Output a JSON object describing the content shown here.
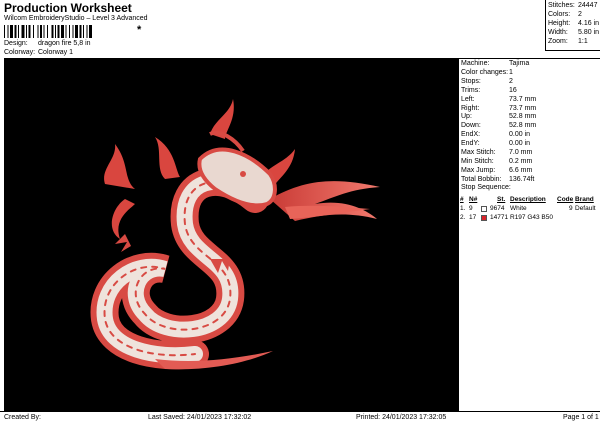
{
  "header": {
    "title": "Production Worksheet",
    "subtitle": "Wilcom EmbroideryStudio – Level 3 Advanced",
    "barcode_star": "*"
  },
  "meta": [
    {
      "key": "Design:",
      "value": "dragon fire 5,8 in"
    },
    {
      "key": "Colorway:",
      "value": "Colorway 1"
    }
  ],
  "summary": [
    {
      "key": "Stitches:",
      "value": "24447"
    },
    {
      "key": "Colors:",
      "value": "2"
    },
    {
      "key": "Height:",
      "value": "4.16 in"
    },
    {
      "key": "Width:",
      "value": "5.80 in"
    },
    {
      "key": "Zoom:",
      "value": "1:1"
    }
  ],
  "details": [
    {
      "key": "Machine:",
      "value": "Tajima"
    },
    {
      "key": "Color changes:",
      "value": "1"
    },
    {
      "key": "Stops:",
      "value": "2"
    },
    {
      "key": "Trims:",
      "value": "16"
    },
    {
      "key": "Left:",
      "value": "73.7 mm"
    },
    {
      "key": "Right:",
      "value": "73.7 mm"
    },
    {
      "key": "Up:",
      "value": "52.8 mm"
    },
    {
      "key": "Down:",
      "value": "52.8 mm"
    },
    {
      "key": "EndX:",
      "value": "0.00 in"
    },
    {
      "key": "EndY:",
      "value": "0.00 in"
    },
    {
      "key": "Max Stitch:",
      "value": "7.0 mm"
    },
    {
      "key": "Min Stitch:",
      "value": "0.2 mm"
    },
    {
      "key": "Max Jump:",
      "value": "6.6 mm"
    },
    {
      "key": "Total Bobbin:",
      "value": "136.74ft"
    }
  ],
  "stop_sequence": {
    "label": "Stop Sequence:",
    "headers": {
      "num": "#",
      "n": "N#",
      "st": "St.",
      "desc": "Description",
      "code": "Code",
      "brand": "Brand"
    },
    "rows": [
      {
        "num": "1.",
        "n": "9",
        "color": "#ffffff",
        "st": "9674",
        "desc": "White",
        "code": "9",
        "brand": "Default"
      },
      {
        "num": "2.",
        "n": "17",
        "color": "#d8232a",
        "st": "14771",
        "desc": "R197 G43 B50",
        "code": "",
        "brand": ""
      }
    ]
  },
  "footer": {
    "created": "Created By:",
    "saved": "Last Saved: 24/01/2023 17:32:02",
    "printed": "Printed: 24/01/2023 17:32:05",
    "page": "Page 1 of 1"
  },
  "colors": {
    "thread_red": "#e85a55",
    "thread_white": "#f0e8e4",
    "background": "#000000"
  }
}
